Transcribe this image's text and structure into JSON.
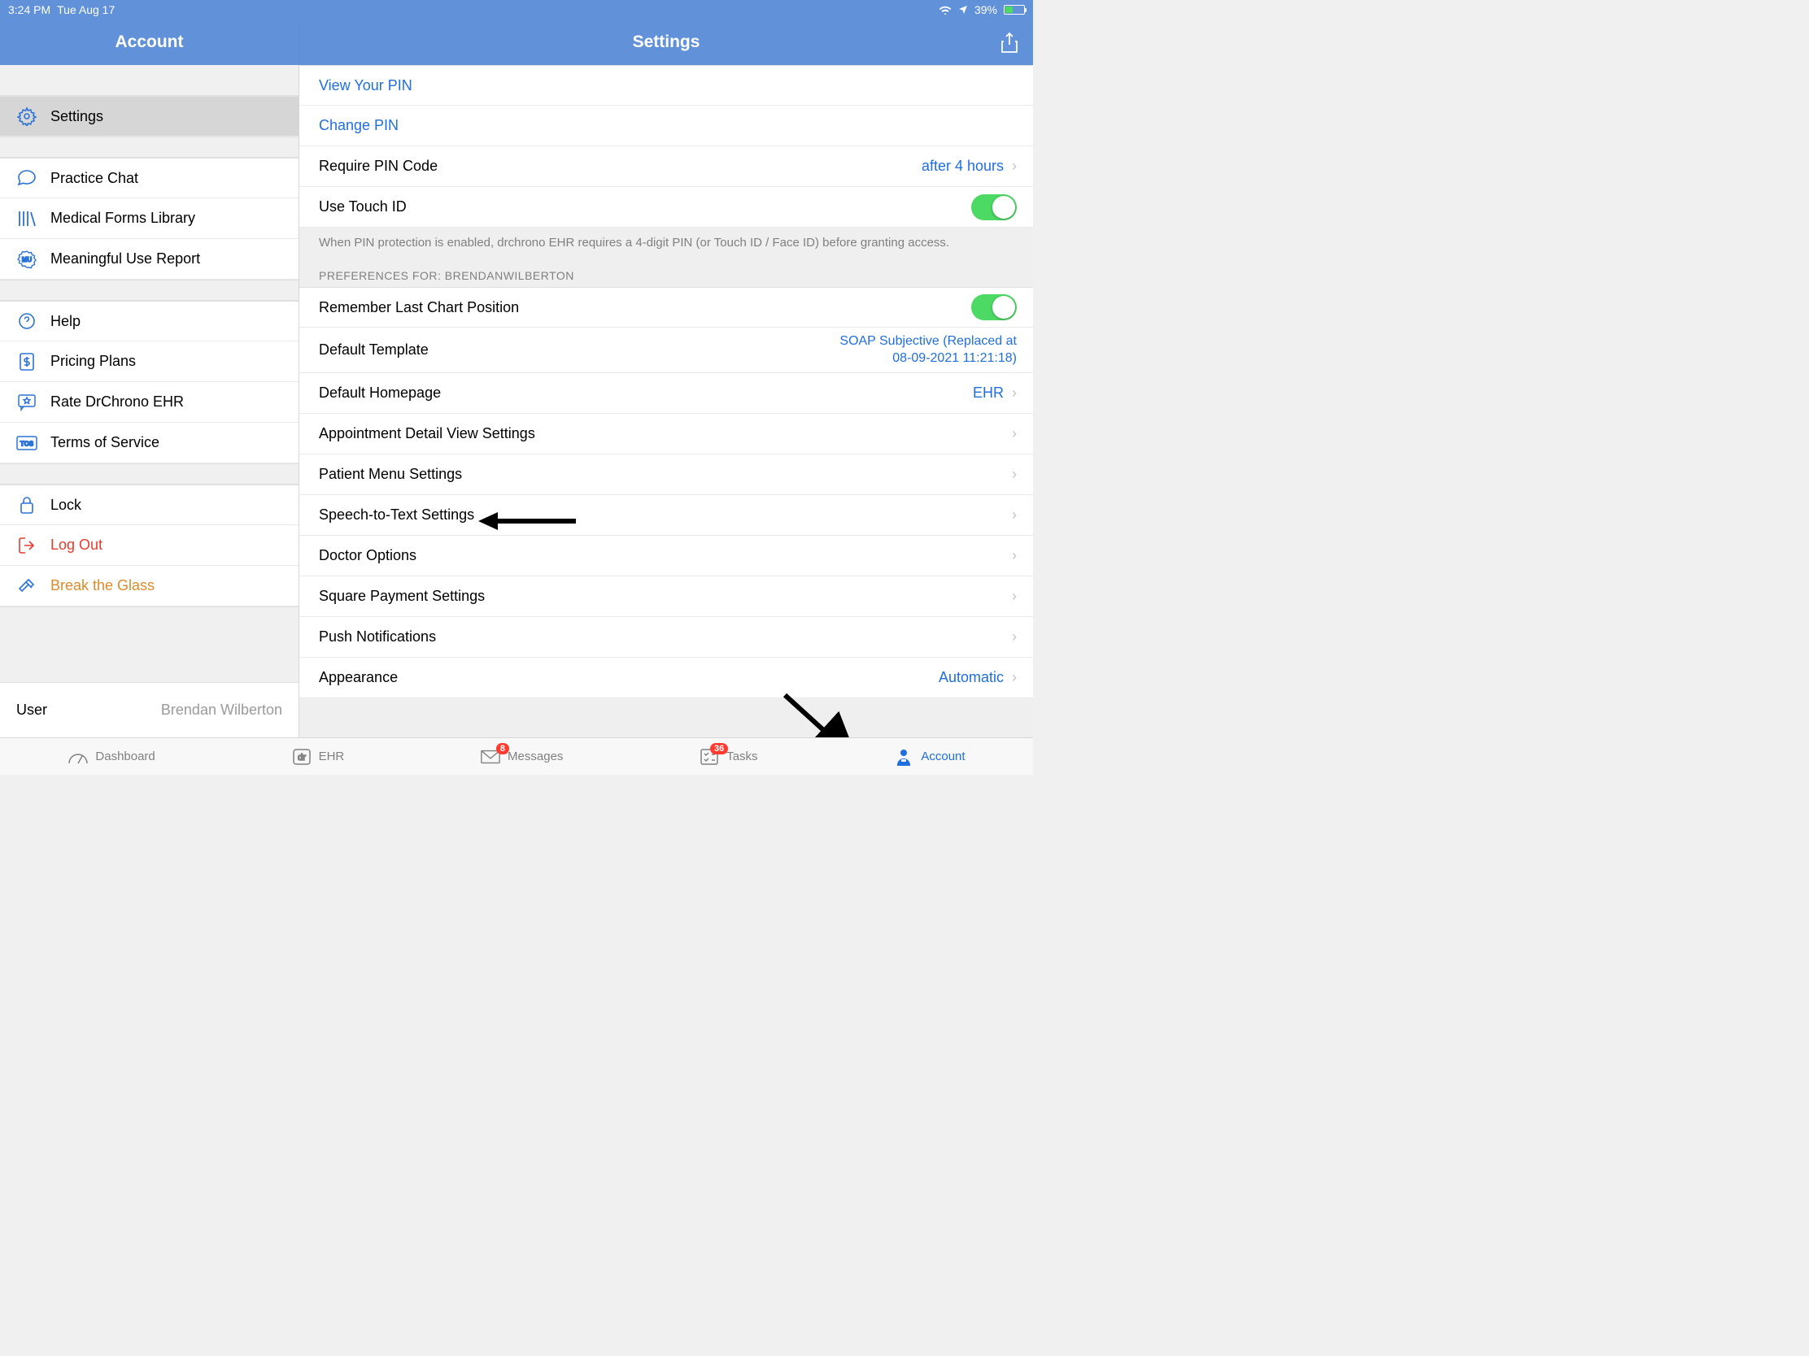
{
  "status": {
    "time": "3:24 PM",
    "date": "Tue Aug 17",
    "battery_pct": "39%"
  },
  "header": {
    "left_title": "Account",
    "right_title": "Settings"
  },
  "sidebar": {
    "settings": "Settings",
    "practice_chat": "Practice Chat",
    "medical_forms": "Medical Forms Library",
    "meaningful_use": "Meaningful Use Report",
    "help": "Help",
    "pricing": "Pricing Plans",
    "rate": "Rate DrChrono EHR",
    "tos": "Terms of Service",
    "lock": "Lock",
    "logout": "Log Out",
    "break_glass": "Break the Glass",
    "user_label": "User",
    "user_name": "Brendan Wilberton"
  },
  "pin": {
    "view": "View Your PIN",
    "change": "Change PIN",
    "require_label": "Require PIN Code",
    "require_value": "after 4 hours",
    "touchid_label": "Use Touch ID",
    "footer": "When PIN protection is enabled, drchrono EHR requires a 4-digit PIN (or Touch ID / Face ID) before granting access."
  },
  "prefs": {
    "header": "PREFERENCES FOR: BRENDANWILBERTON",
    "remember": "Remember Last Chart Position",
    "default_template_label": "Default Template",
    "default_template_value": "SOAP Subjective (Replaced at 08-09-2021 11:21:18)",
    "default_homepage_label": "Default Homepage",
    "default_homepage_value": "EHR",
    "appt_detail": "Appointment Detail View Settings",
    "patient_menu": "Patient Menu Settings",
    "stt": "Speech-to-Text Settings",
    "doctor_options": "Doctor Options",
    "square": "Square Payment Settings",
    "push": "Push Notifications",
    "appearance_label": "Appearance",
    "appearance_value": "Automatic"
  },
  "tabs": {
    "dashboard": "Dashboard",
    "ehr": "EHR",
    "messages": "Messages",
    "messages_badge": "8",
    "tasks": "Tasks",
    "tasks_badge": "36",
    "account": "Account"
  }
}
